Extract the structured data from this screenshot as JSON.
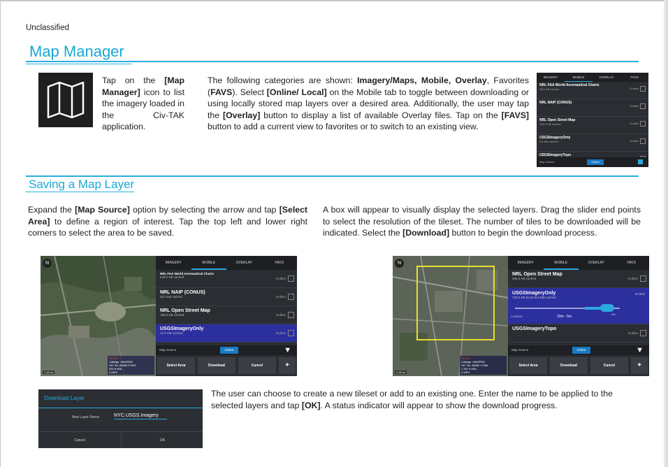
{
  "classification": "Unclassified",
  "section1": {
    "heading": "Map Manager",
    "icon_text": [
      "Tap on the ",
      "[Map Manager]",
      " icon to list the imagery loaded in the Civ-TAK application."
    ],
    "categories_text": {
      "p1": "The following categories are shown: ",
      "b1": "Imagery/Maps, Mobile, Overlay",
      "p2": ", Favorites (",
      "b2": "FAVS",
      "p3": "). Select ",
      "b3": "[Online/ Local]",
      "p4": " on the Mobile tab to toggle between downloading or using locally stored map layers over a desired area. Additionally, the user may tap the ",
      "b4": "[Overlay]",
      "p5": " button to display a list of available Overlay files. Tap on the ",
      "b5": "[FAVS]",
      "p6": " button to add a current view to favorites or to switch to an existing view."
    }
  },
  "small_panel": {
    "tabs": [
      "IMAGERY",
      "MOBILE",
      "OVERLAY",
      "FAVS"
    ],
    "rows": [
      {
        "name": "NRL FAA World Aeronautical Charts",
        "size": "28.0 KB cached",
        "action": "Outline"
      },
      {
        "name": "NRL NAIP (CONUS)",
        "size": "",
        "action": "Outline"
      },
      {
        "name": "NRL Open Street Map",
        "size": "228.0 KB cached",
        "action": "Outline"
      },
      {
        "name": "USGSImageryOnly",
        "size": "6.6 MB cached",
        "action": "Outline"
      },
      {
        "name": "USGSImageryTopo",
        "size": "3.4 MB cached",
        "action": "Outline"
      }
    ],
    "map_source_label": "Map Source",
    "online_label": "Online"
  },
  "section2": {
    "heading": "Saving a Map Layer",
    "left_text": {
      "p1": "Expand the ",
      "b1": "[Map Source]",
      "p2": " option by selecting the arrow and tap ",
      "b2": "[Select Area]",
      "p3": " to define a region of interest. Tap the top left and lower right corners to select the area to be saved."
    },
    "right_text": {
      "p1": "A box will appear to visually display the selected layers. Drag the slider end points to select the resolution of the tileset. The number of tiles to be downloaded will be indicated. Select the ",
      "b1": "[Download]",
      "p2": " button to begin the download process."
    }
  },
  "shot_left": {
    "compass": "N",
    "scale": "1.45 mi",
    "coords": {
      "line1": "Callsign: MAVERIK",
      "line2": "18T WL 80968 27623",
      "line3": "393 ft MSL",
      "line4": "0 MPH",
      "red": "SPEED"
    },
    "tabs": [
      "IMAGERY",
      "MOBILE",
      "OVERLAY",
      "FAVS"
    ],
    "rows": [
      {
        "name": "NRL FAA World Aeronautical Charts",
        "size": "649.0 KB cached",
        "action": "Outline"
      },
      {
        "name": "NRL NAIP (CONUS)",
        "size": "32.0 KB cached",
        "action": "Outline"
      },
      {
        "name": "NRL Open Street Map",
        "size": "196.0 KB cached",
        "action": "Outline"
      },
      {
        "name": "USGSImageryOnly",
        "size": "10.6 MB cached",
        "action": "Outline"
      }
    ],
    "map_source_label": "Map Source",
    "online_label": "Online",
    "buttons": [
      "Select Area",
      "Download",
      "Cancel",
      "+"
    ]
  },
  "shot_right": {
    "compass": "N",
    "scale": "0.35 mi",
    "coords": {
      "line1": "Callsign: MAVERIK",
      "line2": "18T WL 46685 17936",
      "line3": "1,397 ft MSL",
      "line4": "0 MPH",
      "red": "SPEED"
    },
    "tabs": [
      "IMAGERY",
      "MOBILE",
      "OVERLAY",
      "FAVS"
    ],
    "row_top": {
      "name": "NRL Open Street Map",
      "size": "496.0 KB cached",
      "action": "Outline"
    },
    "slider": {
      "name": "USGSImageryOnly",
      "size": "720.0 KB local 26.5 MB cached",
      "tiles": "24 tiles",
      "coarse": "COARSE",
      "range": "10m - 5m",
      "fine": "fine"
    },
    "row_bottom": {
      "name": "USGSImageryTopo",
      "size": "",
      "action": "Outline"
    },
    "map_source_label": "Map Source",
    "online_label": "Online",
    "buttons": [
      "Select Area",
      "Download",
      "Cancel",
      "+"
    ]
  },
  "section3": {
    "text": {
      "p1": "The user can choose to create a new tileset or add to an existing one. Enter the name to be applied to the selected layers and tap ",
      "b1": "[OK]",
      "p2": ". A status indicator will appear to show the download progress."
    }
  },
  "dialog": {
    "title": "Download Layer",
    "field_label": "New Layer Name:",
    "field_value": "NYC.USGS.Imagery",
    "cancel": "Cancel",
    "ok": "OK"
  }
}
